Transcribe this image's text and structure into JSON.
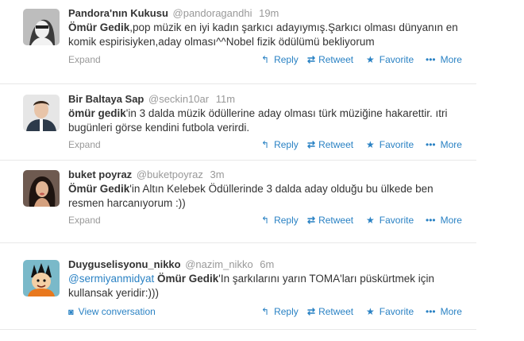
{
  "tweets": [
    {
      "name": "Pandora'nın Kukusu",
      "handle": "@pandoragandhi",
      "time": "19m",
      "highlight": "Ömür Gedik",
      "mention": "",
      "text_after": ",pop müzik en iyi kadın şarkıcı adayıymış.Şarkıcı olması dünyanın en komik espirisiyken,aday olması^^Nobel fizik ödülümü bekliyorum",
      "footer_link": "Expand"
    },
    {
      "name": "Bir Baltaya Sap",
      "handle": "@seckin10ar",
      "time": "11m",
      "highlight": "ömür gedik",
      "mention": "",
      "text_after": "'in 3 dalda müzik ödüllerine aday olması türk müziğine hakarettir. ıtri bugünleri görse kendini futbola verirdi.",
      "footer_link": "Expand"
    },
    {
      "name": "buket poyraz",
      "handle": "@buketpoyraz",
      "time": "3m",
      "highlight": "Ömür Gedik",
      "mention": "",
      "text_after": "'in Altın Kelebek Ödüllerinde 3 dalda aday olduğu bu ülkede ben resmen harcanıyorum :))",
      "footer_link": "Expand"
    },
    {
      "name": "Duyguselisyonu_nikko",
      "handle": "@nazim_nikko",
      "time": "6m",
      "mention": "@sermiyanmidyat",
      "highlight": "Ömür Gedik",
      "text_after": "'In şarkılarını yarın TOMA'ları püskürtmek için kullansak yeridir:)))",
      "footer_link": "View conversation"
    }
  ],
  "actions": {
    "reply": "Reply",
    "retweet": "Retweet",
    "favorite": "Favorite",
    "more": "More"
  },
  "icons": [
    "reply-icon",
    "retweet-icon",
    "favorite-star-icon",
    "more-dots-icon",
    "conversation-bubble-icon"
  ],
  "colors": {
    "link": "#2a82c4",
    "muted": "#999999",
    "text": "#333333",
    "divider": "#e8e8e8"
  }
}
